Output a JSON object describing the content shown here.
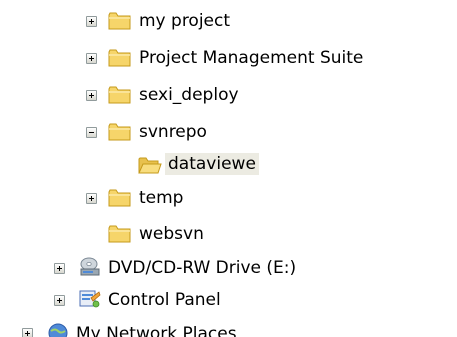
{
  "tree": {
    "items": [
      {
        "label": "my project",
        "icon": "folder-icon",
        "expander": "plus"
      },
      {
        "label": "Project Management Suite",
        "icon": "folder-icon",
        "expander": "plus"
      },
      {
        "label": "sexi_deploy",
        "icon": "folder-icon",
        "expander": "plus"
      },
      {
        "label": "svnrepo",
        "icon": "folder-icon",
        "expander": "minus"
      },
      {
        "label": "dataviewe",
        "icon": "open-folder-icon",
        "expander": "none",
        "selected": true
      },
      {
        "label": "temp",
        "icon": "folder-icon",
        "expander": "plus"
      },
      {
        "label": "websvn",
        "icon": "folder-icon",
        "expander": "none"
      },
      {
        "label": "DVD/CD-RW Drive (E:)",
        "icon": "dvd-drive-icon",
        "expander": "plus"
      },
      {
        "label": "Control Panel",
        "icon": "control-panel-icon",
        "expander": "plus"
      },
      {
        "label": "My Network Places",
        "icon": "network-places-icon",
        "expander": "plus"
      }
    ]
  },
  "colors": {
    "folder": "#f6d56a",
    "folder_edge": "#c59a1b",
    "selection": "#ecebe2",
    "expander_border": "#919b9c"
  }
}
